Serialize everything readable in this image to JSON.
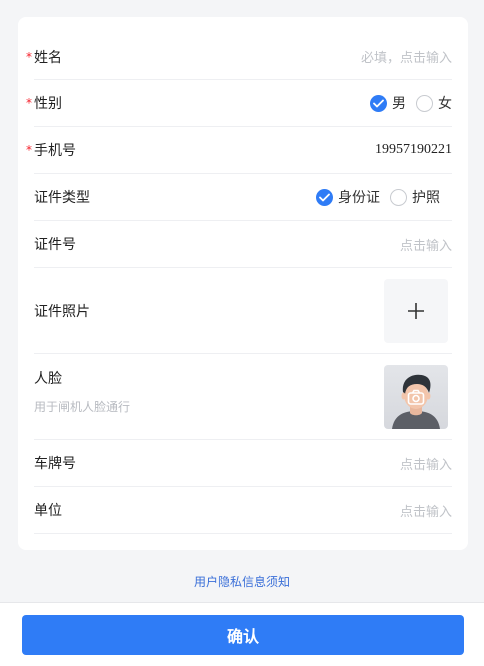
{
  "form": {
    "name": {
      "label": "姓名",
      "required_mark": "*",
      "placeholder": "必填，点击输入"
    },
    "gender": {
      "label": "性别",
      "required_mark": "*",
      "options": [
        "男",
        "女"
      ],
      "selected": "男"
    },
    "phone": {
      "label": "手机号",
      "required_mark": "*",
      "value": "19957190221"
    },
    "id_type": {
      "label": "证件类型",
      "options": [
        "身份证",
        "护照"
      ],
      "selected": "身份证"
    },
    "id_number": {
      "label": "证件号",
      "placeholder": "点击输入"
    },
    "id_photo": {
      "label": "证件照片",
      "upload_icon": "plus-icon"
    },
    "face": {
      "label": "人脸",
      "hint": "用于闸机人脸通行",
      "icon": "camera-icon"
    },
    "plate": {
      "label": "车牌号",
      "placeholder": "点击输入"
    },
    "unit": {
      "label": "单位",
      "placeholder": "点击输入"
    }
  },
  "privacy_link": "用户隐私信息须知",
  "confirm_button": "确认",
  "colors": {
    "primary": "#2f7cf6",
    "required": "#f5222d",
    "placeholder": "#c0c3c8",
    "link": "#3a6fd8"
  }
}
